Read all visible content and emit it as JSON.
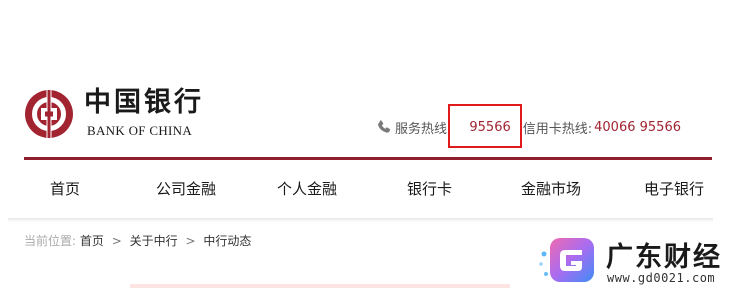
{
  "brand": {
    "name_cn": "中国银行",
    "name_en": "BANK OF CHINA",
    "logo_color": "#a22430"
  },
  "hotlines": {
    "service_label": "服务热线:",
    "service_number": "95566",
    "credit_label": "信用卡热线:",
    "credit_number": "40066 95566",
    "icon": "phone-icon",
    "number_color": "#a22430"
  },
  "nav": {
    "items": [
      {
        "label": "首页"
      },
      {
        "label": "公司金融"
      },
      {
        "label": "个人金融"
      },
      {
        "label": "银行卡"
      },
      {
        "label": "金融市场"
      },
      {
        "label": "电子银行"
      }
    ]
  },
  "breadcrumb": {
    "prefix": "当前位置:",
    "items": [
      "首页",
      "关于中行",
      "中行动态"
    ],
    "separator": ">"
  },
  "watermark": {
    "name": "广东财经",
    "url": "www.gd0021.com"
  },
  "annotation": {
    "highlight_color": "#e0191b"
  }
}
